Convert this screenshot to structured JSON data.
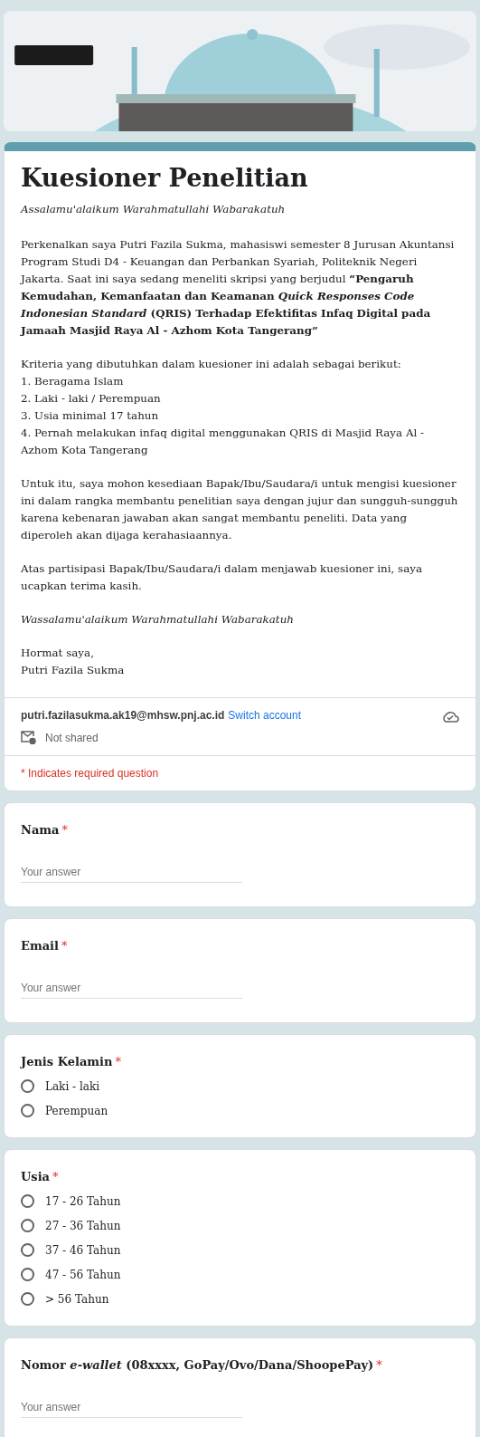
{
  "header": {
    "title": "Kuesioner Penelitian",
    "paragraphs": [
      {
        "kind": "italic",
        "lines": [
          "Assalamu'alaikum Warahmatullahi Wabarakatuh"
        ]
      },
      {
        "kind": "plain",
        "lines": [
          "Perkenalkan saya Putri Fazila Sukma, mahasiswi semester 8 Jurusan Akuntansi Program Studi D4 - Keuangan dan Perbankan Syariah, Politeknik Negeri Jakarta. Saat ini saya sedang meneliti skripsi yang berjudul **“Pengaruh Kemudahan, Kemanfaatan dan Keamanan *Quick Responses Code Indonesian Standard* (QRIS) Terhadap Efektifitas Infaq Digital pada Jamaah Masjid Raya Al - Azhom Kota Tangerang”**"
        ]
      },
      {
        "kind": "plain",
        "lines": [
          "Kriteria yang dibutuhkan dalam kuesioner ini adalah sebagai berikut:",
          "1. Beragama Islam",
          "2. Laki - laki / Perempuan",
          "3. Usia minimal 17 tahun",
          "4. Pernah melakukan infaq digital menggunakan QRIS di Masjid Raya Al - Azhom Kota Tangerang"
        ]
      },
      {
        "kind": "plain",
        "lines": [
          "Untuk itu, saya mohon kesediaan Bapak/Ibu/Saudara/i untuk mengisi kuesioner ini dalam rangka membantu penelitian saya dengan jujur dan sungguh-sungguh karena kebenaran jawaban akan sangat membantu peneliti. Data yang diperoleh akan dijaga kerahasiaannya."
        ]
      },
      {
        "kind": "plain",
        "lines": [
          "Atas partisipasi Bapak/Ibu/Saudara/i dalam menjawab kuesioner ini, saya ucapkan terima kasih."
        ]
      },
      {
        "kind": "italic",
        "lines": [
          "Wassalamu'alaikum Warahmatullahi Wabarakatuh"
        ]
      },
      {
        "kind": "plain",
        "lines": [
          "Hormat saya,",
          "Putri Fazila Sukma"
        ]
      }
    ],
    "account": {
      "email": "putri.fazilasukma.ak19@mhsw.pnj.ac.id",
      "switch": "Switch account",
      "shared": "Not shared"
    },
    "required_note": "* Indicates required question"
  },
  "questions": [
    {
      "kind": "text",
      "title": "Nama",
      "required_mark": "*",
      "placeholder": "Your answer"
    },
    {
      "kind": "text",
      "title": "Email",
      "required_mark": "*",
      "placeholder": "Your answer"
    },
    {
      "kind": "radio",
      "title": "Jenis Kelamin",
      "required_mark": "*",
      "options": [
        {
          "label": "Laki - laki",
          "selected": false
        },
        {
          "label": "Perempuan",
          "selected": false
        }
      ]
    },
    {
      "kind": "radio",
      "title": "Usia",
      "required_mark": "*",
      "options": [
        {
          "label": "17 - 26 Tahun",
          "selected": false
        },
        {
          "label": "27 - 36 Tahun",
          "selected": false
        },
        {
          "label": "37 - 46 Tahun",
          "selected": false
        },
        {
          "label": "47 - 56 Tahun",
          "selected": false
        },
        {
          "label": "> 56 Tahun",
          "selected": false
        }
      ]
    },
    {
      "kind": "text",
      "title": "Nomor *e-wallet* (08xxxx, GoPay/Ovo/Dana/ShoopePay)",
      "required_mark": "*",
      "placeholder": "Your answer"
    }
  ]
}
